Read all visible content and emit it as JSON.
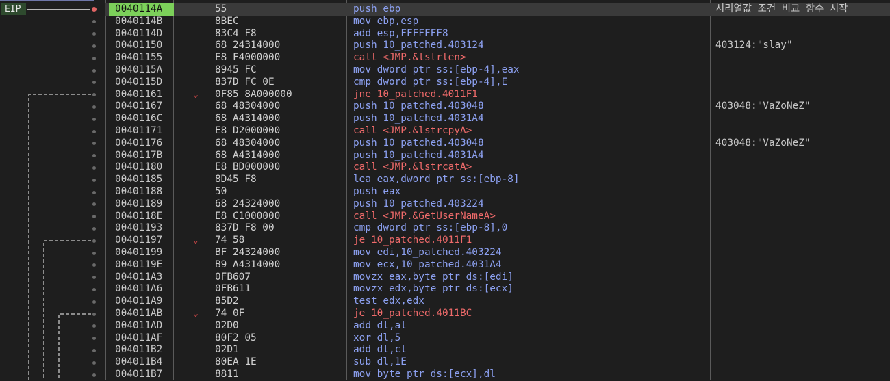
{
  "eip_label": "EIP",
  "rows": [
    {
      "addr": "0040114A",
      "bytes": "55",
      "instr": "push ebp",
      "comment": "시리얼값 조건 비교 함수 시작",
      "type": "push",
      "selected": true,
      "jump_arrow": ""
    },
    {
      "addr": "0040114B",
      "bytes": "8BEC",
      "instr": "mov ebp,esp",
      "comment": "",
      "type": "mov",
      "jump_arrow": ""
    },
    {
      "addr": "0040114D",
      "bytes": "83C4 F8",
      "instr": "add esp,FFFFFFF8",
      "comment": "",
      "type": "arith",
      "jump_arrow": ""
    },
    {
      "addr": "00401150",
      "bytes": "68 24314000",
      "instr": "push 10_patched.403124",
      "comment": "403124:\"slay\"",
      "type": "push",
      "jump_arrow": ""
    },
    {
      "addr": "00401155",
      "bytes": "E8 F4000000",
      "instr": "call <JMP.&lstrlen>",
      "comment": "",
      "type": "call",
      "jump_arrow": ""
    },
    {
      "addr": "0040115A",
      "bytes": "8945 FC",
      "instr": "mov dword ptr ss:[ebp-4],eax",
      "comment": "",
      "type": "mov",
      "jump_arrow": ""
    },
    {
      "addr": "0040115D",
      "bytes": "837D FC 0E",
      "instr": "cmp dword ptr ss:[ebp-4],E",
      "comment": "",
      "type": "cmp",
      "jump_arrow": ""
    },
    {
      "addr": "00401161",
      "bytes": "0F85 8A000000",
      "instr": "jne 10_patched.4011F1",
      "comment": "",
      "type": "jmp",
      "jump_arrow": "⌄"
    },
    {
      "addr": "00401167",
      "bytes": "68 48304000",
      "instr": "push 10_patched.403048",
      "comment": "403048:\"VaZoNeZ\"",
      "type": "push",
      "jump_arrow": ""
    },
    {
      "addr": "0040116C",
      "bytes": "68 A4314000",
      "instr": "push 10_patched.4031A4",
      "comment": "",
      "type": "push",
      "jump_arrow": ""
    },
    {
      "addr": "00401171",
      "bytes": "E8 D2000000",
      "instr": "call <JMP.&lstrcpyA>",
      "comment": "",
      "type": "call",
      "jump_arrow": ""
    },
    {
      "addr": "00401176",
      "bytes": "68 48304000",
      "instr": "push 10_patched.403048",
      "comment": "403048:\"VaZoNeZ\"",
      "type": "push",
      "jump_arrow": ""
    },
    {
      "addr": "0040117B",
      "bytes": "68 A4314000",
      "instr": "push 10_patched.4031A4",
      "comment": "",
      "type": "push",
      "jump_arrow": ""
    },
    {
      "addr": "00401180",
      "bytes": "E8 BD000000",
      "instr": "call <JMP.&lstrcatA>",
      "comment": "",
      "type": "call",
      "jump_arrow": ""
    },
    {
      "addr": "00401185",
      "bytes": "8D45 F8",
      "instr": "lea eax,dword ptr ss:[ebp-8]",
      "comment": "",
      "type": "mov",
      "jump_arrow": ""
    },
    {
      "addr": "00401188",
      "bytes": "50",
      "instr": "push eax",
      "comment": "",
      "type": "push",
      "jump_arrow": ""
    },
    {
      "addr": "00401189",
      "bytes": "68 24324000",
      "instr": "push 10_patched.403224",
      "comment": "",
      "type": "push",
      "jump_arrow": ""
    },
    {
      "addr": "0040118E",
      "bytes": "E8 C1000000",
      "instr": "call <JMP.&GetUserNameA>",
      "comment": "",
      "type": "call",
      "jump_arrow": ""
    },
    {
      "addr": "00401193",
      "bytes": "837D F8 00",
      "instr": "cmp dword ptr ss:[ebp-8],0",
      "comment": "",
      "type": "cmp",
      "jump_arrow": ""
    },
    {
      "addr": "00401197",
      "bytes": "74 58",
      "instr": "je 10_patched.4011F1",
      "comment": "",
      "type": "jmp",
      "jump_arrow": "⌄"
    },
    {
      "addr": "00401199",
      "bytes": "BF 24324000",
      "instr": "mov edi,10_patched.403224",
      "comment": "",
      "type": "mov",
      "jump_arrow": ""
    },
    {
      "addr": "0040119E",
      "bytes": "B9 A4314000",
      "instr": "mov ecx,10_patched.4031A4",
      "comment": "",
      "type": "mov",
      "jump_arrow": ""
    },
    {
      "addr": "004011A3",
      "bytes": "0FB607",
      "instr": "movzx eax,byte ptr ds:[edi]",
      "comment": "",
      "type": "mov",
      "jump_arrow": ""
    },
    {
      "addr": "004011A6",
      "bytes": "0FB611",
      "instr": "movzx edx,byte ptr ds:[ecx]",
      "comment": "",
      "type": "mov",
      "jump_arrow": ""
    },
    {
      "addr": "004011A9",
      "bytes": "85D2",
      "instr": "test edx,edx",
      "comment": "",
      "type": "cmp",
      "jump_arrow": ""
    },
    {
      "addr": "004011AB",
      "bytes": "74 0F",
      "instr": "je 10_patched.4011BC",
      "comment": "",
      "type": "jmp",
      "jump_arrow": "⌄"
    },
    {
      "addr": "004011AD",
      "bytes": "02D0",
      "instr": "add dl,al",
      "comment": "",
      "type": "arith",
      "jump_arrow": ""
    },
    {
      "addr": "004011AF",
      "bytes": "80F2 05",
      "instr": "xor dl,5",
      "comment": "",
      "type": "arith",
      "jump_arrow": ""
    },
    {
      "addr": "004011B2",
      "bytes": "02D1",
      "instr": "add dl,cl",
      "comment": "",
      "type": "arith",
      "jump_arrow": ""
    },
    {
      "addr": "004011B4",
      "bytes": "80EA 1E",
      "instr": "sub dl,1E",
      "comment": "",
      "type": "arith",
      "jump_arrow": ""
    },
    {
      "addr": "004011B7",
      "bytes": "8811",
      "instr": "mov byte ptr ds:[ecx],dl",
      "comment": "",
      "type": "mov",
      "jump_arrow": ""
    }
  ]
}
